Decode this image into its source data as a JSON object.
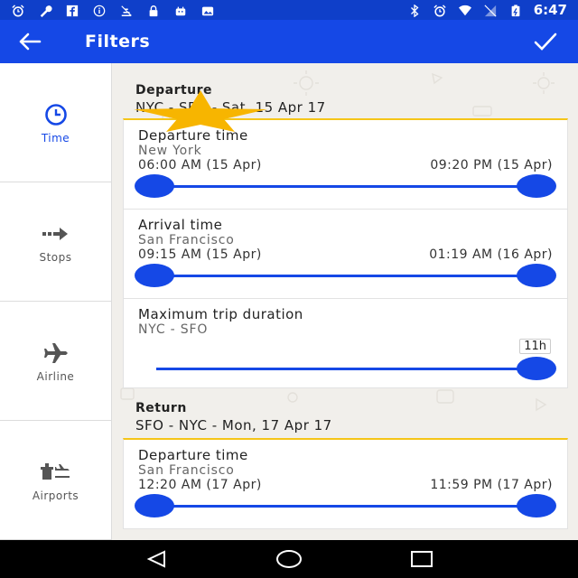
{
  "status_bar": {
    "time": "6:47",
    "icons_left": [
      "alarm-icon",
      "wrench-icon",
      "facebook-icon",
      "info-icon",
      "no-signal-icon",
      "lock-icon",
      "bag-icon",
      "photo-icon"
    ],
    "icons_right": [
      "bluetooth-icon",
      "alarm-icon",
      "wifi-icon",
      "signal-icon",
      "battery-icon"
    ]
  },
  "app_bar": {
    "title": "Filters"
  },
  "sidebar": {
    "items": [
      {
        "label": "Time",
        "icon": "clock-icon",
        "active": true
      },
      {
        "label": "Stops",
        "icon": "stops-arrow-icon",
        "active": false
      },
      {
        "label": "Airline",
        "icon": "airplane-icon",
        "active": false
      },
      {
        "label": "Airports",
        "icon": "airport-icon",
        "active": false
      }
    ]
  },
  "departure": {
    "heading": "Departure",
    "route": "NYC - SFO - Sat, 15 Apr 17",
    "departure_time": {
      "title": "Departure time",
      "city": "New York",
      "min": "06:00 AM (15 Apr)",
      "max": "09:20 PM (15 Apr)"
    },
    "arrival_time": {
      "title": "Arrival time",
      "city": "San Francisco",
      "min": "09:15 AM (15 Apr)",
      "max": "01:19 AM (16 Apr)"
    },
    "duration": {
      "title": "Maximum trip duration",
      "route": "NYC - SFO",
      "value": "11h"
    }
  },
  "return": {
    "heading": "Return",
    "route": "SFO - NYC - Mon, 17 Apr 17",
    "departure_time": {
      "title": "Departure time",
      "city": "San Francisco",
      "min": "12:20 AM (17 Apr)",
      "max": "11:59 PM (17 Apr)"
    }
  },
  "colors": {
    "primary": "#1548e6",
    "status_bar": "#0f3fc9",
    "accent_bar": "#f5c518",
    "star": "#f7b500",
    "background": "#f1efeb"
  }
}
